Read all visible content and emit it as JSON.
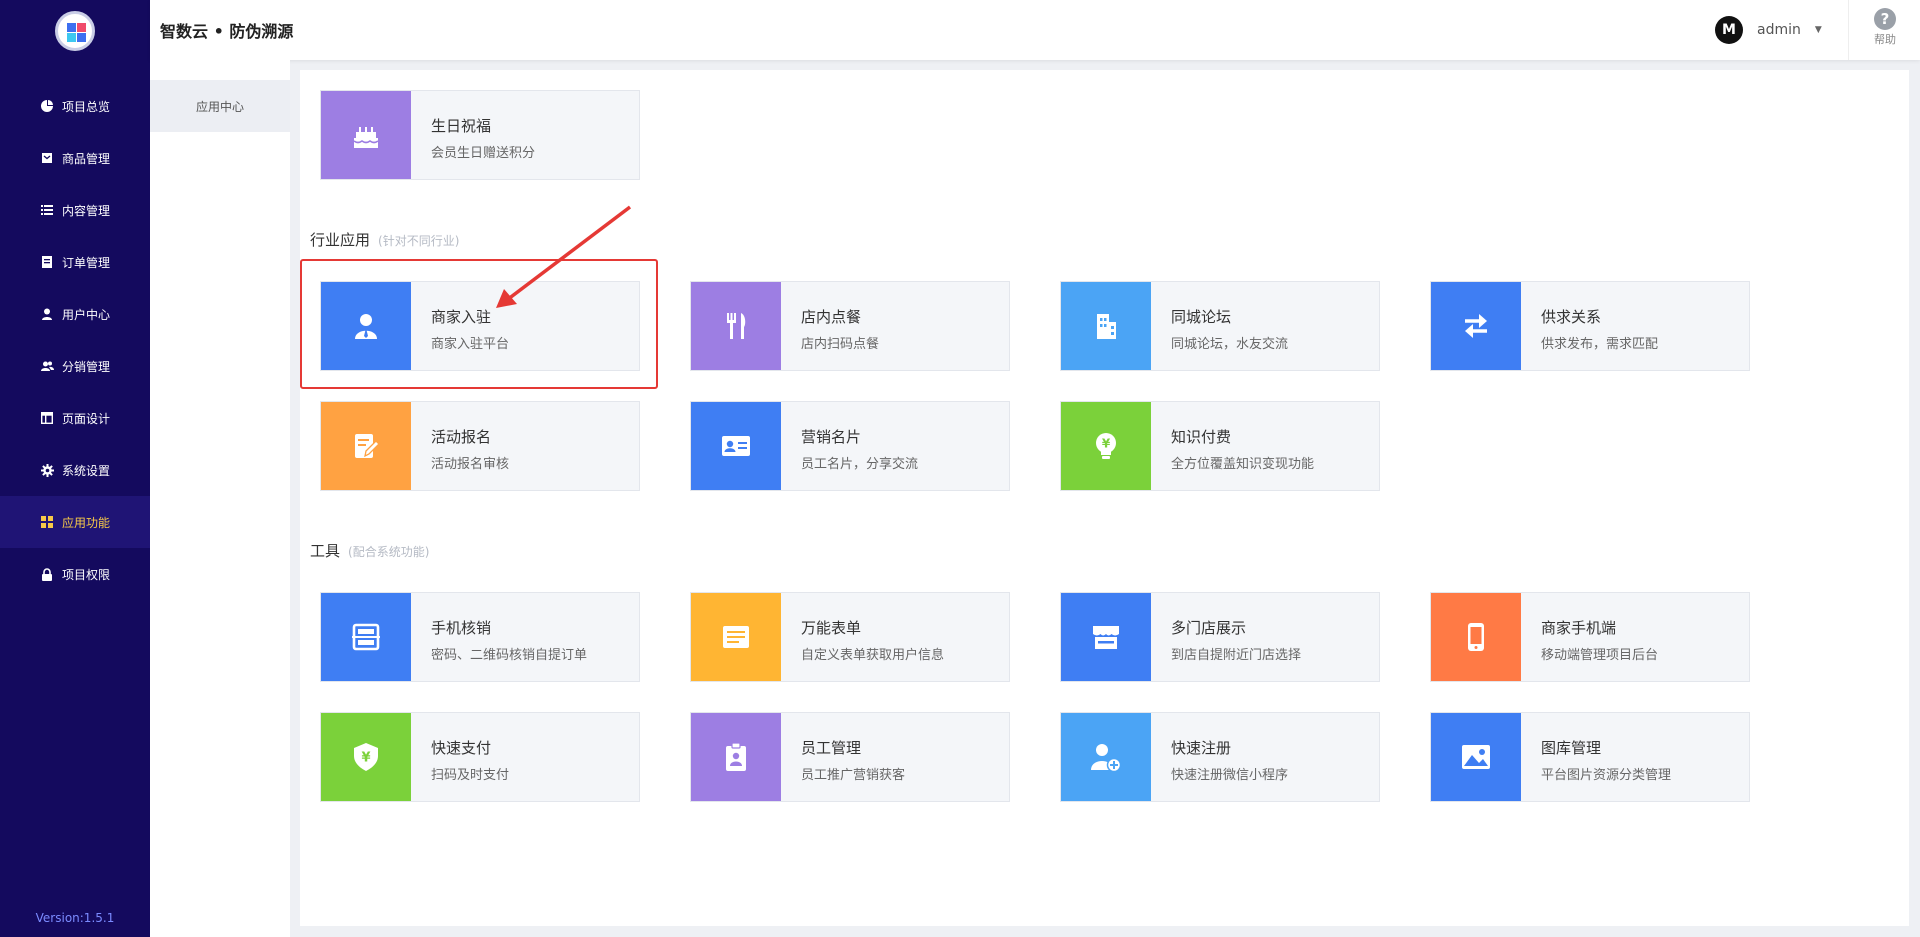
{
  "app": {
    "brand": "智数云 • 防伪溯源",
    "version": "Version:1.5.1"
  },
  "sidebar": {
    "items": [
      {
        "label": "项目总览",
        "icon": "pie-chart-icon"
      },
      {
        "label": "商品管理",
        "icon": "box-icon"
      },
      {
        "label": "内容管理",
        "icon": "list-icon"
      },
      {
        "label": "订单管理",
        "icon": "document-icon"
      },
      {
        "label": "用户中心",
        "icon": "user-icon"
      },
      {
        "label": "分销管理",
        "icon": "users-icon"
      },
      {
        "label": "页面设计",
        "icon": "layout-icon"
      },
      {
        "label": "系统设置",
        "icon": "gear-icon"
      },
      {
        "label": "应用功能",
        "icon": "grid-icon",
        "active": true
      },
      {
        "label": "项目权限",
        "icon": "lock-icon"
      }
    ]
  },
  "subsidebar": {
    "item": "应用中心"
  },
  "header": {
    "username": "admin",
    "avatar_letter": "M",
    "help_label": "帮助"
  },
  "top_card": {
    "name": "生日祝福",
    "desc": "会员生日赠送积分",
    "color": "#9d7ee3",
    "icon": "cake-icon"
  },
  "sections": {
    "industry": {
      "title": "行业应用",
      "subtitle": "(针对不同行业)",
      "cards": [
        {
          "name": "商家入驻",
          "desc": "商家入驻平台",
          "color": "#3f7ef3",
          "icon": "merchant-icon"
        },
        {
          "name": "店内点餐",
          "desc": "店内扫码点餐",
          "color": "#9d7ee3",
          "icon": "fork-knife-icon"
        },
        {
          "name": "同城论坛",
          "desc": "同城论坛，水友交流",
          "color": "#4ba4f5",
          "icon": "building-icon"
        },
        {
          "name": "供求关系",
          "desc": "供求发布，需求匹配",
          "color": "#3f7ef3",
          "icon": "swap-arrows-icon"
        },
        {
          "name": "活动报名",
          "desc": "活动报名审核",
          "color": "#ffa242",
          "icon": "edit-form-icon"
        },
        {
          "name": "营销名片",
          "desc": "员工名片，分享交流",
          "color": "#3f7ef3",
          "icon": "id-card-icon"
        },
        {
          "name": "知识付费",
          "desc": "全方位覆盖知识变现功能",
          "color": "#7bd13a",
          "icon": "bulb-yen-icon"
        }
      ]
    },
    "tools": {
      "title": "工具",
      "subtitle": "(配合系统功能)",
      "cards": [
        {
          "name": "手机核销",
          "desc": "密码、二维码核销自提订单",
          "color": "#3f7ef3",
          "icon": "scan-icon"
        },
        {
          "name": "万能表单",
          "desc": "自定义表单获取用户信息",
          "color": "#ffb533",
          "icon": "form-icon"
        },
        {
          "name": "多门店展示",
          "desc": "到店自提附近门店选择",
          "color": "#3f7ef3",
          "icon": "store-icon"
        },
        {
          "name": "商家手机端",
          "desc": "移动端管理项目后台",
          "color": "#ff7a45",
          "icon": "mobile-icon"
        },
        {
          "name": "快速支付",
          "desc": "扫码及时支付",
          "color": "#7bd13a",
          "icon": "shield-yen-icon"
        },
        {
          "name": "员工管理",
          "desc": "员工推广营销获客",
          "color": "#9d7ee3",
          "icon": "badge-icon"
        },
        {
          "name": "快速注册",
          "desc": "快速注册微信小程序",
          "color": "#4ba4f5",
          "icon": "user-add-icon"
        },
        {
          "name": "图库管理",
          "desc": "平台图片资源分类管理",
          "color": "#3f7ef3",
          "icon": "image-icon"
        }
      ]
    }
  },
  "annotation": {
    "highlight_color": "#e53935"
  }
}
